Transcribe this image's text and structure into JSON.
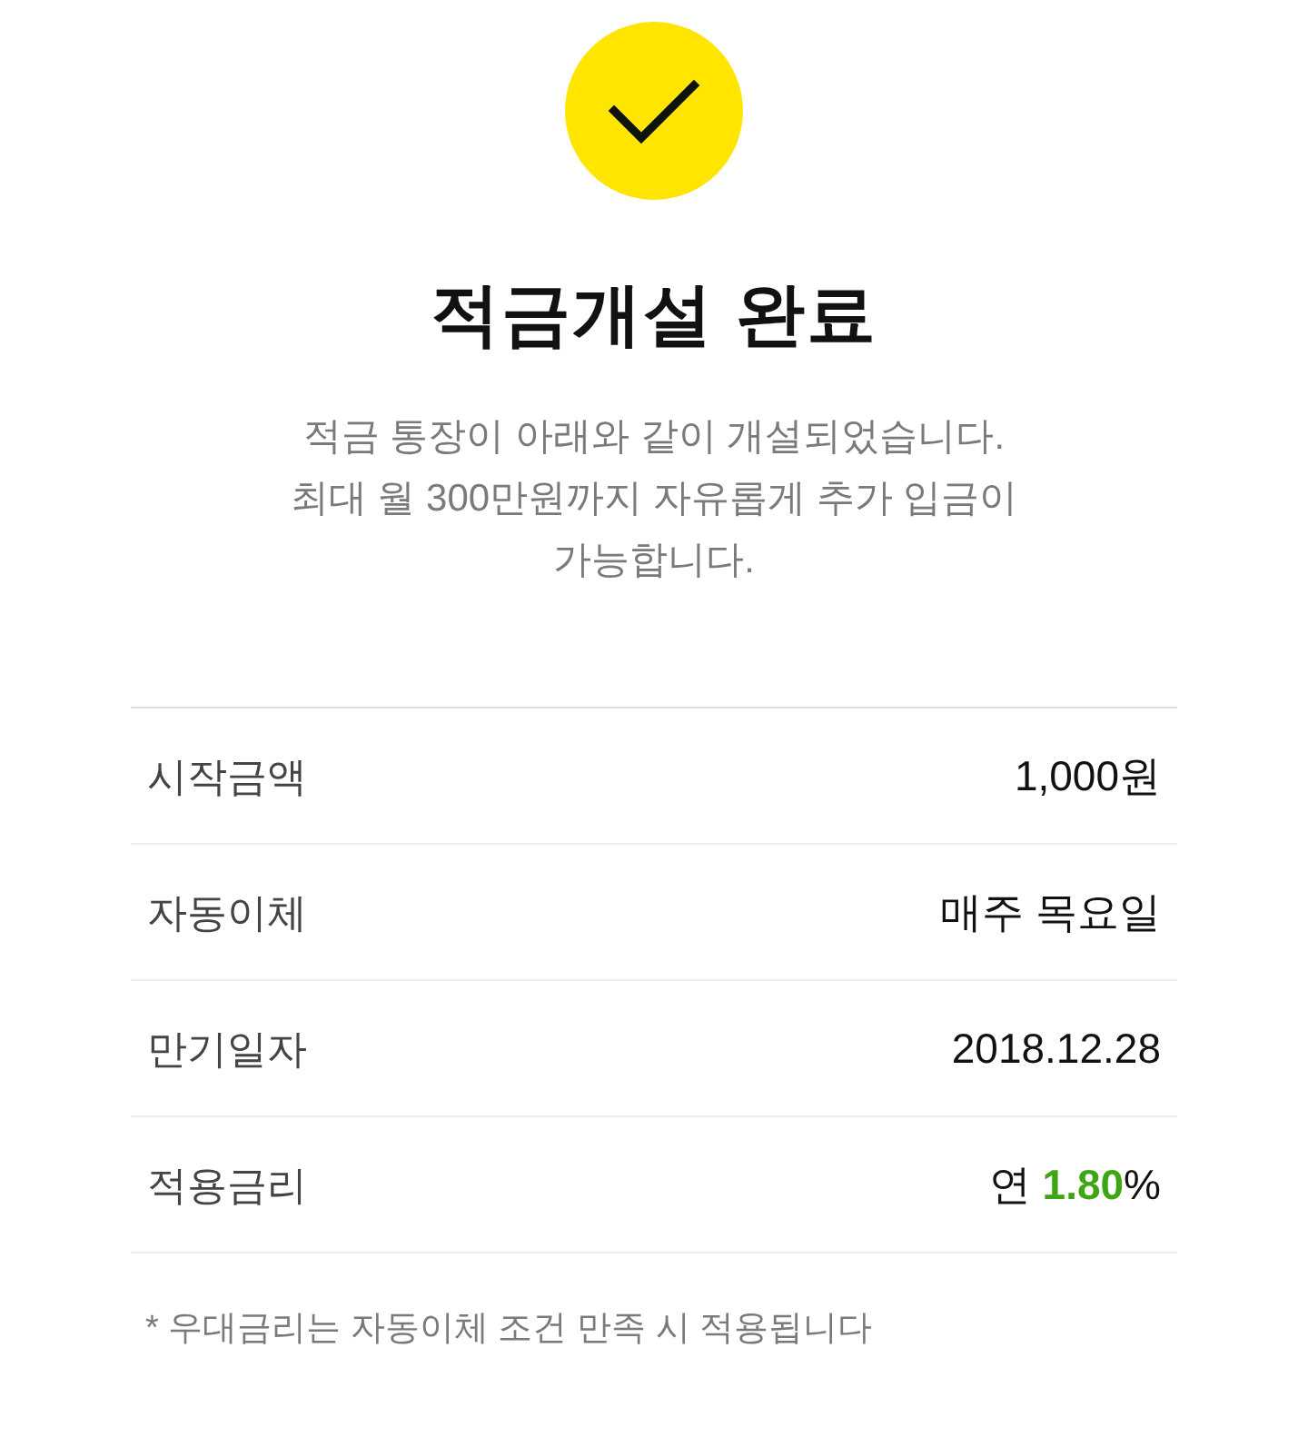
{
  "title": "적금개설 완료",
  "description_lines": [
    "적금 통장이 아래와 같이 개설되었습니다.",
    "최대 월 300만원까지 자유롭게 추가 입금이",
    "가능합니다."
  ],
  "details": [
    {
      "label": "시작금액",
      "value": "1,000원"
    },
    {
      "label": "자동이체",
      "value": "매주 목요일"
    },
    {
      "label": "만기일자",
      "value": "2018.12.28"
    },
    {
      "label": "적용금리",
      "value": "연 **1.80**%"
    }
  ],
  "footnote": "* 우대금리는 자동이체 조건 만족 시 적용됩니다"
}
